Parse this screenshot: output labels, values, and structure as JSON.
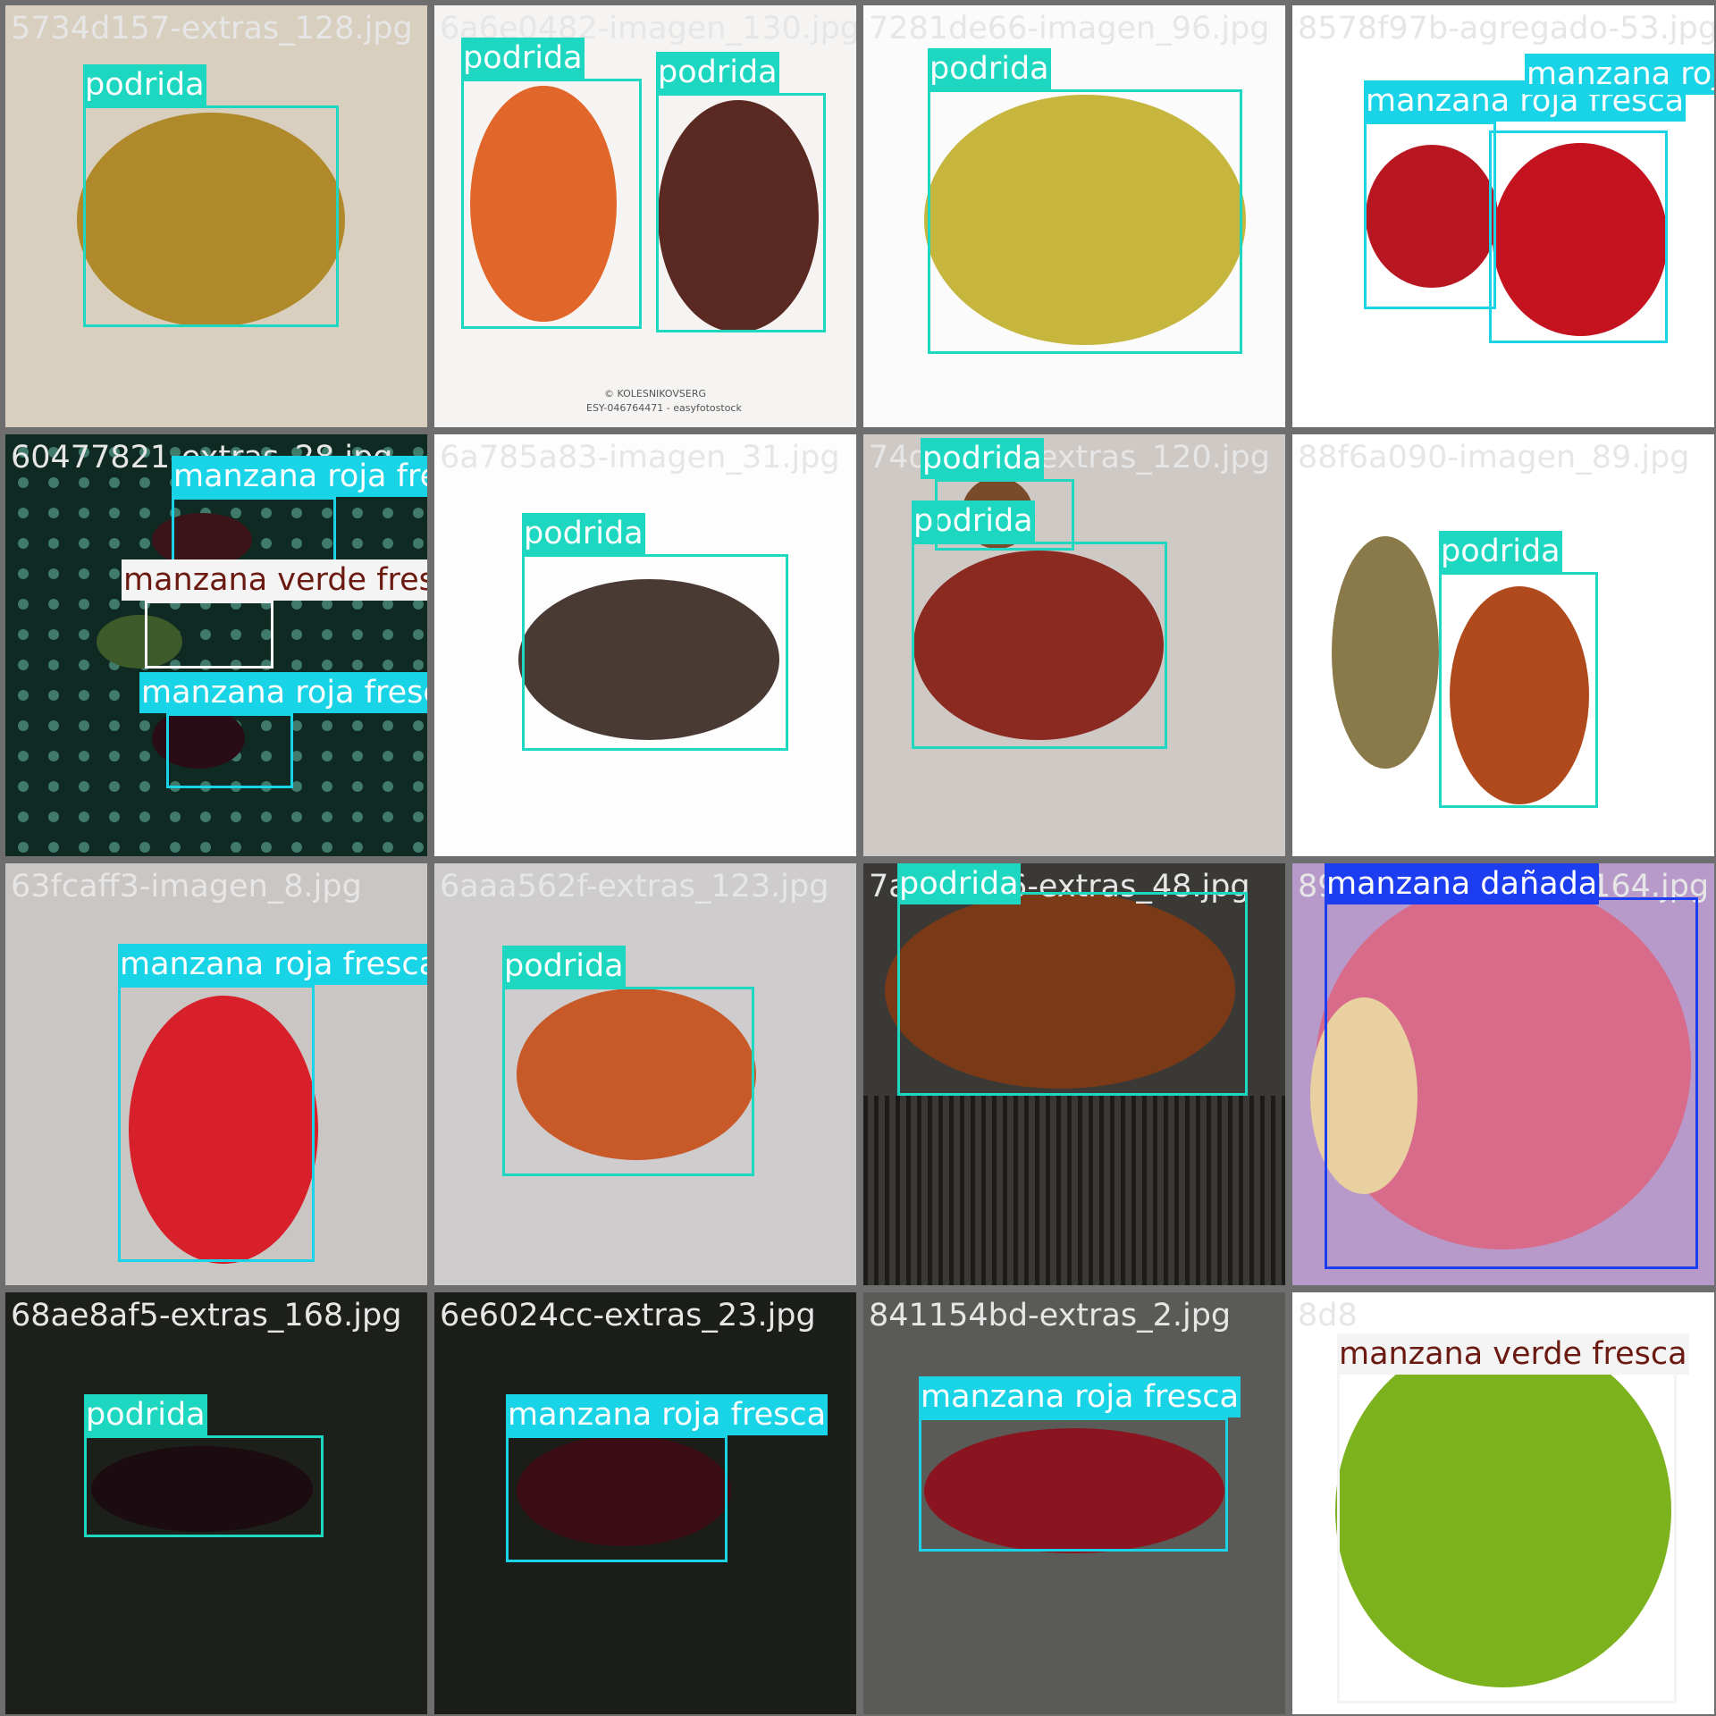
{
  "title": "",
  "colors": {
    "podrida": "#1dd7c0",
    "manzana_roja_fresca": "#19d3e6",
    "manzana_verde_fresca": "#f4f4f4",
    "manzana_danada": "#1d3ef0",
    "filename_text": "#e6e6e6",
    "grid_border": "#6e6e6e"
  },
  "tiles": [
    {
      "filename": "5734d157-extras_128.jpg",
      "scene": "brown rotten apple on tiled floor",
      "detections": [
        {
          "label": "podrida"
        }
      ]
    },
    {
      "filename": "6a6e0482-imagen_130.jpg",
      "scene": "two rotten apples on white",
      "detections": [
        {
          "label": "podrida"
        },
        {
          "label": "podrida"
        }
      ],
      "caption": "© KOLESNIKOVSERG",
      "caption2": "ESY-046764471 - easyfotostock"
    },
    {
      "filename": "7281de66-imagen_96.jpg",
      "scene": "spotted yellow apple",
      "detections": [
        {
          "label": "podrida"
        }
      ]
    },
    {
      "filename": "8578f97b-agregado-53.jpg",
      "scene": "two red apples with leaf",
      "detections": [
        {
          "label": "manzana roja fresca"
        },
        {
          "label": "manzana roja fresca"
        }
      ]
    },
    {
      "filename": "60477821-extras_28.jpg",
      "scene": "dark dotted fabric with apples",
      "detections": [
        {
          "label": "manzana roja fresca"
        },
        {
          "label": "manzana verde fresca"
        },
        {
          "label": "manzana roja fresca"
        }
      ]
    },
    {
      "filename": "6a785a83-imagen_31.jpg",
      "scene": "moldy rotten apple",
      "detections": [
        {
          "label": "podrida"
        }
      ]
    },
    {
      "filename": "74d18a54-extras_120.jpg",
      "scene": "rotten apple on white table",
      "detections": [
        {
          "label": "podrida"
        },
        {
          "label": "podrida"
        }
      ]
    },
    {
      "filename": "88f6a090-imagen_89.jpg",
      "scene": "withered apple with dry leaves",
      "detections": [
        {
          "label": "podrida"
        }
      ]
    },
    {
      "filename": "63fcaff3-imagen_8.jpg",
      "scene": "fresh red apple with leaf",
      "detections": [
        {
          "label": "manzana roja fresca"
        }
      ]
    },
    {
      "filename": "6aaa562f-extras_123.jpg",
      "scene": "partially rotten apple",
      "detections": [
        {
          "label": "podrida"
        }
      ]
    },
    {
      "filename": "7a1d0296-extras_48.jpg",
      "scene": "shriveled apple on striped cloth",
      "detections": [
        {
          "label": "podrida"
        }
      ]
    },
    {
      "filename": "89fe981e-imagen_164.jpg",
      "scene": "bitten pink apple in hand",
      "detections": [
        {
          "label": "manzana dañada"
        }
      ]
    },
    {
      "filename": "68ae8af5-extras_168.jpg",
      "scene": "dark apple in low light",
      "detections": [
        {
          "label": "podrida"
        }
      ]
    },
    {
      "filename": "6e6024cc-extras_23.jpg",
      "scene": "dark red apple",
      "detections": [
        {
          "label": "manzana roja fresca"
        }
      ]
    },
    {
      "filename": "841154bd-extras_2.jpg",
      "scene": "red apple on gray surface",
      "detections": [
        {
          "label": "manzana roja fresca"
        }
      ]
    },
    {
      "filename": "8d8",
      "scene": "fresh green apple",
      "detections": [
        {
          "label": "manzana verde fresca"
        }
      ]
    }
  ]
}
